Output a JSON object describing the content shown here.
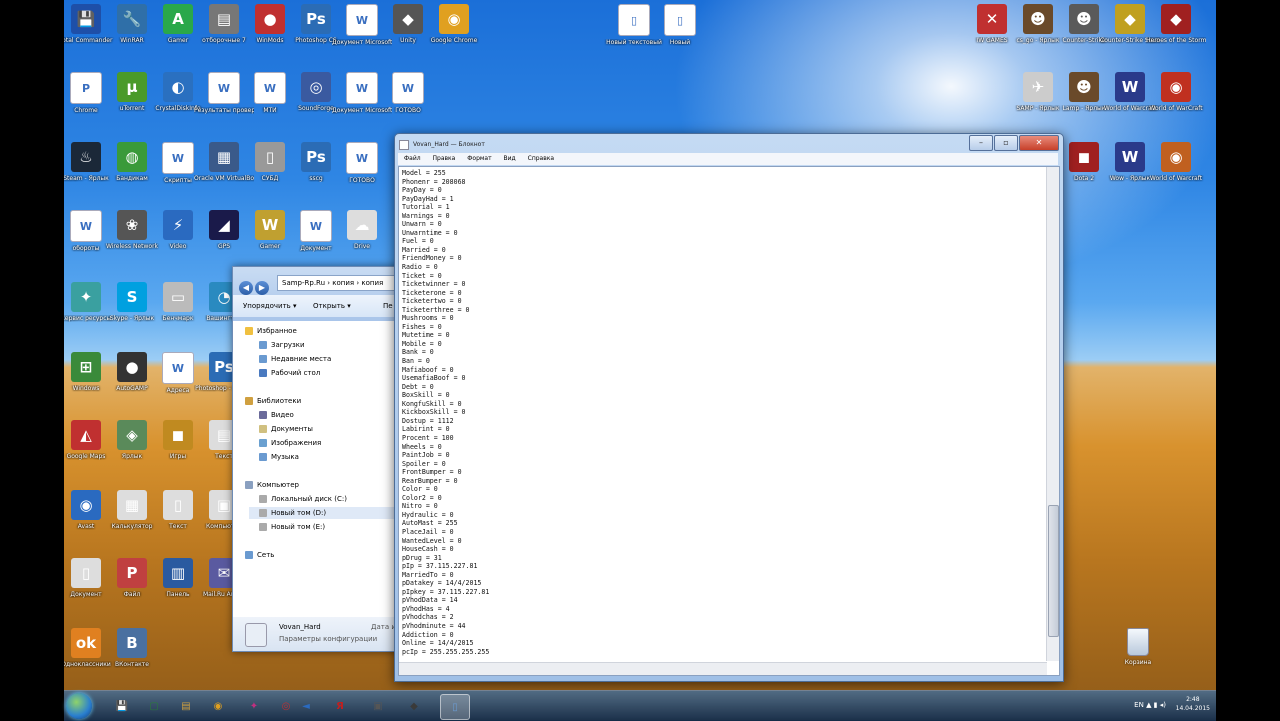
{
  "desktop": {
    "icons_left": [
      {
        "id": "i1",
        "label": "Total Commander",
        "glyph": "💾",
        "color": "#1e4fa8"
      },
      {
        "id": "i2",
        "label": "WinRAR",
        "glyph": "🔧",
        "color": "#2f6fa8"
      },
      {
        "id": "i3",
        "label": "Gamer",
        "glyph": "A",
        "color": "#2aa84a"
      },
      {
        "id": "i4",
        "label": "отборочные 7",
        "glyph": "▤",
        "color": "#777"
      },
      {
        "id": "i5",
        "label": "WinMods",
        "glyph": "●",
        "color": "#c03030"
      },
      {
        "id": "i6",
        "label": "Photoshop CS",
        "glyph": "Ps",
        "color": "#2b6cb5"
      },
      {
        "id": "i7",
        "label": "Документ Microsoft",
        "glyph": "W",
        "color": "doc"
      },
      {
        "id": "i8",
        "label": "Unity",
        "glyph": "◆",
        "color": "#555"
      },
      {
        "id": "i9",
        "label": "Google Chrome",
        "glyph": "◉",
        "color": "#e0a020"
      },
      {
        "id": "i10",
        "label": "Chrome",
        "glyph": "P",
        "color": "doc"
      },
      {
        "id": "i11",
        "label": "uTorrent",
        "glyph": "µ",
        "color": "#4a9a2a"
      },
      {
        "id": "i12",
        "label": "CrystalDiskInfo",
        "glyph": "◐",
        "color": "#2a70c0"
      },
      {
        "id": "i13",
        "label": "Результаты проверки",
        "glyph": "W",
        "color": "doc"
      },
      {
        "id": "i14",
        "label": "МТИ",
        "glyph": "W",
        "color": "doc"
      },
      {
        "id": "i15",
        "label": "SoundForge",
        "glyph": "◎",
        "color": "#3a5aa0"
      },
      {
        "id": "i16",
        "label": "Документ Microsoft",
        "glyph": "W",
        "color": "doc"
      },
      {
        "id": "i17",
        "label": "ГОТОВО",
        "glyph": "W",
        "color": "doc"
      },
      {
        "id": "i18",
        "label": "Steam - Ярлык",
        "glyph": "♨",
        "color": "#1b2838"
      },
      {
        "id": "i19",
        "label": "Бандикам",
        "glyph": "◍",
        "color": "#3a9a3a"
      },
      {
        "id": "i20",
        "label": "Скрипты",
        "glyph": "W",
        "color": "doc"
      },
      {
        "id": "i21",
        "label": "Oracle VM VirtualBox",
        "glyph": "▦",
        "color": "#3a5a8a"
      },
      {
        "id": "i22",
        "label": "СУБД",
        "glyph": "▯",
        "color": "#999"
      },
      {
        "id": "i23",
        "label": "sscg",
        "glyph": "Ps",
        "color": "#2b6cb5"
      },
      {
        "id": "i24",
        "label": "ГОТОВО",
        "glyph": "W",
        "color": "doc"
      },
      {
        "id": "i25",
        "label": "обороты",
        "glyph": "W",
        "color": "doc"
      },
      {
        "id": "i26",
        "label": "Wireless Network",
        "glyph": "❀",
        "color": "#555"
      },
      {
        "id": "i27",
        "label": "Video",
        "glyph": "⚡",
        "color": "#2a6ac0"
      },
      {
        "id": "i28",
        "label": "GPS",
        "glyph": "◢",
        "color": "#1a1a4a"
      },
      {
        "id": "i29",
        "label": "Gamer",
        "glyph": "W",
        "color": "#c0a030"
      },
      {
        "id": "i30",
        "label": "Документ",
        "glyph": "W",
        "color": "doc"
      },
      {
        "id": "i31",
        "label": "Drive",
        "glyph": "☁",
        "color": "#ddd"
      },
      {
        "id": "i32",
        "label": "Сервис ресурсы",
        "glyph": "✦",
        "color": "#3aa0a0"
      },
      {
        "id": "i33",
        "label": "Skype - Ярлык",
        "glyph": "S",
        "color": "#00a0e0"
      },
      {
        "id": "i34",
        "label": "Бенчмарк",
        "glyph": "▭",
        "color": "#bbb"
      },
      {
        "id": "i35",
        "label": "Вашингтон",
        "glyph": "◔",
        "color": "#2a8ac0"
      },
      {
        "id": "i36",
        "label": "Windows",
        "glyph": "⊞",
        "color": "#3a8a3a"
      },
      {
        "id": "i37",
        "label": "AutoGAMP",
        "glyph": "●",
        "color": "#333"
      },
      {
        "id": "i38",
        "label": "Адреса",
        "glyph": "W",
        "color": "doc"
      },
      {
        "id": "i39",
        "label": "Photoshop - Ярлык",
        "glyph": "Ps",
        "color": "#2b6cb5"
      },
      {
        "id": "i40",
        "label": "Google Maps",
        "glyph": "◭",
        "color": "#c03030"
      },
      {
        "id": "i41",
        "label": "Ярлык",
        "glyph": "◈",
        "color": "#5a8a5a"
      },
      {
        "id": "i42",
        "label": "Игры",
        "glyph": "◼",
        "color": "#c08a20"
      },
      {
        "id": "i43",
        "label": "Текст",
        "glyph": "▤",
        "color": "#ddd"
      },
      {
        "id": "i44",
        "label": "Avast",
        "glyph": "◉",
        "color": "#2a6ac0"
      },
      {
        "id": "i45",
        "label": "Калькулятор",
        "glyph": "▦",
        "color": "#ddd"
      },
      {
        "id": "i46",
        "label": "Текст",
        "glyph": "▯",
        "color": "#ddd"
      },
      {
        "id": "i47",
        "label": "Компьютер",
        "glyph": "▣",
        "color": "#ddd"
      },
      {
        "id": "i48",
        "label": "Документ",
        "glyph": "▯",
        "color": "#ddd"
      },
      {
        "id": "i49",
        "label": "Файл",
        "glyph": "P",
        "color": "#c04040"
      },
      {
        "id": "i50",
        "label": "Панель",
        "glyph": "▥",
        "color": "#2a5aa0"
      },
      {
        "id": "i51",
        "label": "Mail.Ru Агент",
        "glyph": "✉",
        "color": "#5a5aa0"
      },
      {
        "id": "i52",
        "label": "Одноклассники",
        "glyph": "ok",
        "color": "#e08020"
      },
      {
        "id": "i53",
        "label": "ВКонтакте",
        "glyph": "B",
        "color": "#4a70a0"
      }
    ],
    "icons_top_mid": [
      {
        "id": "m1",
        "label": "Новый текстовый",
        "glyph": "▯",
        "color": "doc"
      },
      {
        "id": "m2",
        "label": "Новый",
        "glyph": "▯",
        "color": "doc"
      }
    ],
    "icons_right": [
      {
        "id": "r1",
        "label": "IW GAMES",
        "glyph": "✕",
        "color": "#c03030"
      },
      {
        "id": "r2",
        "label": "cs_go - Ярлык",
        "glyph": "☻",
        "color": "#6a4a2a"
      },
      {
        "id": "r3",
        "label": "Counter-Strike",
        "glyph": "☻",
        "color": "#5a5a5a"
      },
      {
        "id": "r4",
        "label": "Counter-Strike Source",
        "glyph": "◆",
        "color": "#c0a020"
      },
      {
        "id": "r5",
        "label": "Heroes of the Storm",
        "glyph": "◆",
        "color": "#a02020"
      },
      {
        "id": "r6",
        "label": "SAMP - Ярлык",
        "glyph": "✈",
        "color": "#ccc"
      },
      {
        "id": "r7",
        "label": "Lamp - Ярлык",
        "glyph": "☻",
        "color": "#6a4a2a"
      },
      {
        "id": "r8",
        "label": "World of Warcraft",
        "glyph": "W",
        "color": "#2a3a8a"
      },
      {
        "id": "r9",
        "label": "World of WarCraft",
        "glyph": "◉",
        "color": "#c03020"
      },
      {
        "id": "r10",
        "label": "Dota 2",
        "glyph": "◼",
        "color": "#a02020"
      },
      {
        "id": "r11",
        "label": "Wow - Ярлык",
        "glyph": "W",
        "color": "#2a3a8a"
      },
      {
        "id": "r12",
        "label": "World of Warcraft",
        "glyph": "◉",
        "color": "#c06020"
      }
    ],
    "recycle_label": "Корзина"
  },
  "explorer": {
    "address": "Samp-Rp.Ru › копия › копия",
    "toolbar": [
      "Упорядочить ▾",
      "Открыть ▾",
      "Пе"
    ],
    "tree": [
      {
        "label": "Избранное",
        "icon": "#f0c040",
        "indent": 0,
        "selected": false
      },
      {
        "label": "Загрузки",
        "icon": "#6a9ad0",
        "indent": 1,
        "selected": false
      },
      {
        "label": "Недавние места",
        "icon": "#6a9ad0",
        "indent": 1,
        "selected": false
      },
      {
        "label": "Рабочий стол",
        "icon": "#4a7ac0",
        "indent": 1,
        "selected": false
      },
      {
        "label": "Библиотеки",
        "icon": "#d0a040",
        "indent": 0,
        "selected": false
      },
      {
        "label": "Видео",
        "icon": "#6a6a9a",
        "indent": 1,
        "selected": false
      },
      {
        "label": "Документы",
        "icon": "#d0c080",
        "indent": 1,
        "selected": false
      },
      {
        "label": "Изображения",
        "icon": "#6aa0d0",
        "indent": 1,
        "selected": false
      },
      {
        "label": "Музыка",
        "icon": "#6a9ad0",
        "indent": 1,
        "selected": false
      },
      {
        "label": "Компьютер",
        "icon": "#8aa0c0",
        "indent": 0,
        "selected": false
      },
      {
        "label": "Локальный диск (C:)",
        "icon": "#aaa",
        "indent": 1,
        "selected": false
      },
      {
        "label": "Новый том (D:)",
        "icon": "#aaa",
        "indent": 1,
        "selected": true
      },
      {
        "label": "Новый том (E:)",
        "icon": "#aaa",
        "indent": 1,
        "selected": false
      },
      {
        "label": "Сеть",
        "icon": "#6a9ad0",
        "indent": 0,
        "selected": false
      }
    ],
    "status_name": "Vovan_Hard",
    "status_type": "Параметры конфигурации",
    "status_date": "Дата и"
  },
  "notepad": {
    "title": "Vovan_Hard — Блокнот",
    "menu": [
      "Файл",
      "Правка",
      "Формат",
      "Вид",
      "Справка"
    ],
    "lines": [
      "Model = 255",
      "Phonenr = 208068",
      "PayDay = 0",
      "PayDayHad = 1",
      "Tutorial = 1",
      "Warnings = 0",
      "Unwarn = 0",
      "Unwarntime = 0",
      "Fuel = 0",
      "Married = 0",
      "FriendMoney = 0",
      "Radio = 0",
      "Ticket = 0",
      "Ticketwinner = 0",
      "Ticketerone = 0",
      "Ticketertwo = 0",
      "Ticketerthree = 0",
      "Mushrooms = 0",
      "Fishes = 0",
      "Mutetime = 0",
      "Mobile = 0",
      "Bank = 0",
      "Ban = 0",
      "Mafiaboof = 0",
      "UsemafiaBoof = 0",
      "Debt = 0",
      "BoxSkill = 0",
      "KongfuSkill = 0",
      "KickboxSkill = 0",
      "Dostup = 1112",
      "Labirint = 0",
      "Procent = 100",
      "Wheels = 0",
      "PaintJob = 0",
      "Spoiler = 0",
      "FrontBumper = 0",
      "RearBumper = 0",
      "Color = 0",
      "Color2 = 0",
      "Nitro = 0",
      "Hydraulic = 0",
      "AutoMast = 255",
      "PlaceJail = 0",
      "WantedLevel = 0",
      "HouseCash = 0",
      "pDrug = 31",
      "pIp = 37.115.227.81",
      "MarriedTo = 0",
      "pDatakey = 14/4/2015",
      "pIpkey = 37.115.227.81",
      "pVhodData = 14",
      "pVhodHas = 4",
      "pVhodchas = 2",
      "pVhodminute = 44",
      "Addiction = 0",
      "Online = 14/4/2015",
      "pcIp = 255.255.255.255"
    ]
  },
  "taskbar": {
    "items": [
      {
        "id": "t1",
        "glyph": "💾",
        "color": "#3a6ac0",
        "active": false
      },
      {
        "id": "t2",
        "glyph": "▢",
        "color": "#2a7a3a",
        "active": false
      },
      {
        "id": "t3",
        "glyph": "▤",
        "color": "#d0a040",
        "active": false
      },
      {
        "id": "t4",
        "glyph": "◉",
        "color": "#e0a020",
        "active": false
      },
      {
        "id": "t5",
        "glyph": "✦",
        "color": "#c03080",
        "active": false
      },
      {
        "id": "t6",
        "glyph": "◎",
        "color": "#c03030",
        "active": false
      },
      {
        "id": "t7",
        "glyph": "◄",
        "color": "#2a6ac0",
        "active": false
      },
      {
        "id": "t8",
        "glyph": "Я",
        "color": "#c02020",
        "active": false
      },
      {
        "id": "t9",
        "glyph": "▣",
        "color": "#555",
        "active": false
      },
      {
        "id": "t10",
        "glyph": "◆",
        "color": "#3a3a3a",
        "active": false
      },
      {
        "id": "t11",
        "glyph": "▯",
        "color": "#6a9ad0",
        "active": true
      }
    ],
    "lang": "EN",
    "time": "2:48",
    "date": "14.04.2015"
  }
}
